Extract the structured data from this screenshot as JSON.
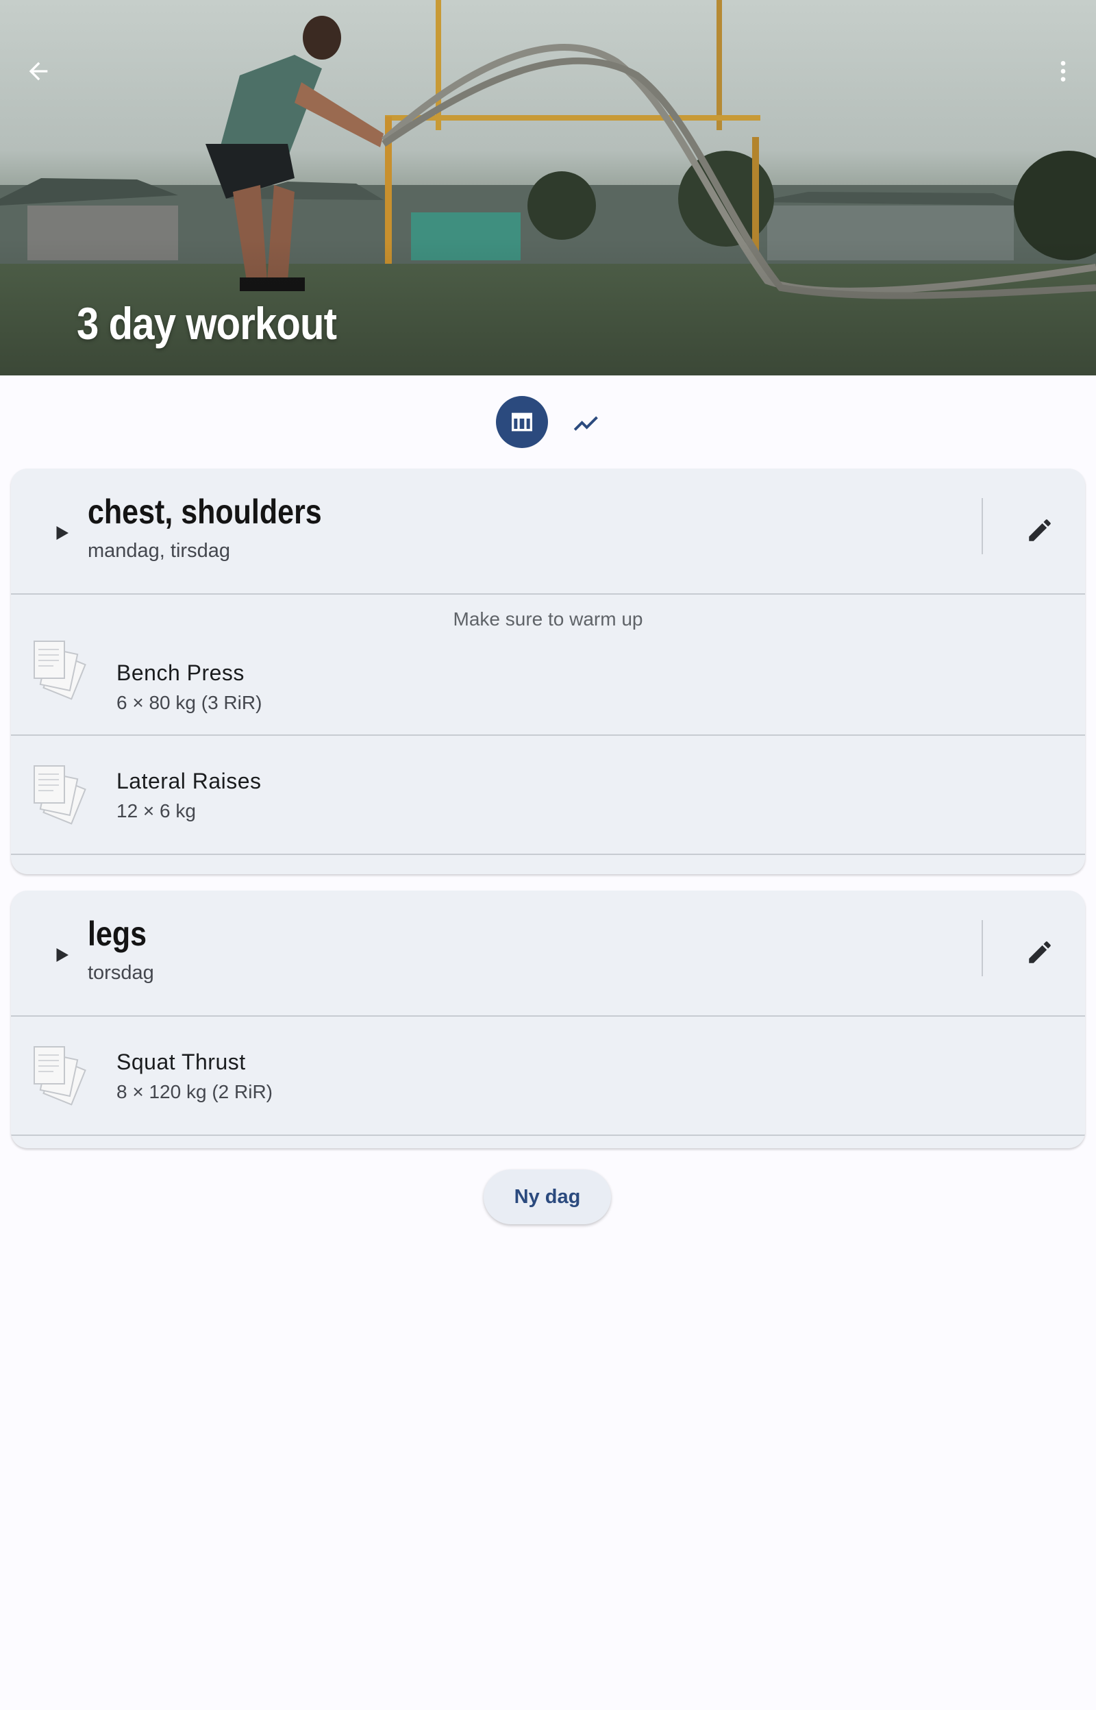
{
  "header": {
    "title": "3 day workout",
    "back_icon": "arrow-back-icon",
    "more_icon": "more-vert-icon"
  },
  "view_toggle": {
    "options": [
      {
        "icon": "table-icon",
        "active": true
      },
      {
        "icon": "trending-up-icon",
        "active": false
      }
    ]
  },
  "days": [
    {
      "name": "chest, shoulders",
      "weekdays": "mandag, tirsdag",
      "note": "Make sure to warm up",
      "exercises": [
        {
          "name": "Bench Press",
          "detail": "6 × 80 kg  (3 RiR)"
        },
        {
          "name": "Lateral Raises",
          "detail": "12 × 6 kg"
        }
      ]
    },
    {
      "name": "legs",
      "weekdays": "torsdag",
      "exercises": [
        {
          "name": "Squat Thrust",
          "detail": "8 × 120 kg  (2 RiR)"
        }
      ]
    }
  ],
  "new_day_label": "Ny dag",
  "colors": {
    "primary": "#2b4a7e",
    "card_bg": "#edf0f5",
    "page_bg": "#fcfbff"
  }
}
